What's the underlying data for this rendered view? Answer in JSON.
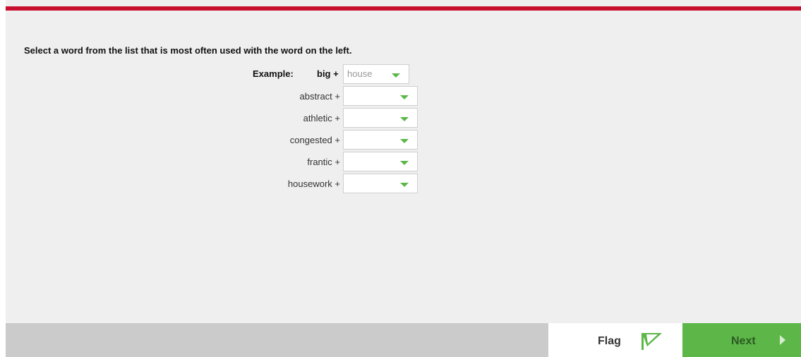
{
  "instruction": "Select a word from the list that is most often used with the word on the left.",
  "example": {
    "label": "Example:",
    "word": "big +",
    "answer": "house"
  },
  "rows": [
    {
      "word": "abstract +",
      "value": ""
    },
    {
      "word": "athletic +",
      "value": ""
    },
    {
      "word": "congested +",
      "value": ""
    },
    {
      "word": "frantic +",
      "value": ""
    },
    {
      "word": "housework +",
      "value": ""
    }
  ],
  "footer": {
    "flag_label": "Flag",
    "next_label": "Next"
  },
  "colors": {
    "accent_red": "#c8102e",
    "accent_green": "#5cb748"
  },
  "icons": [
    "chevron-down-icon",
    "flag-icon",
    "arrow-right-icon"
  ]
}
